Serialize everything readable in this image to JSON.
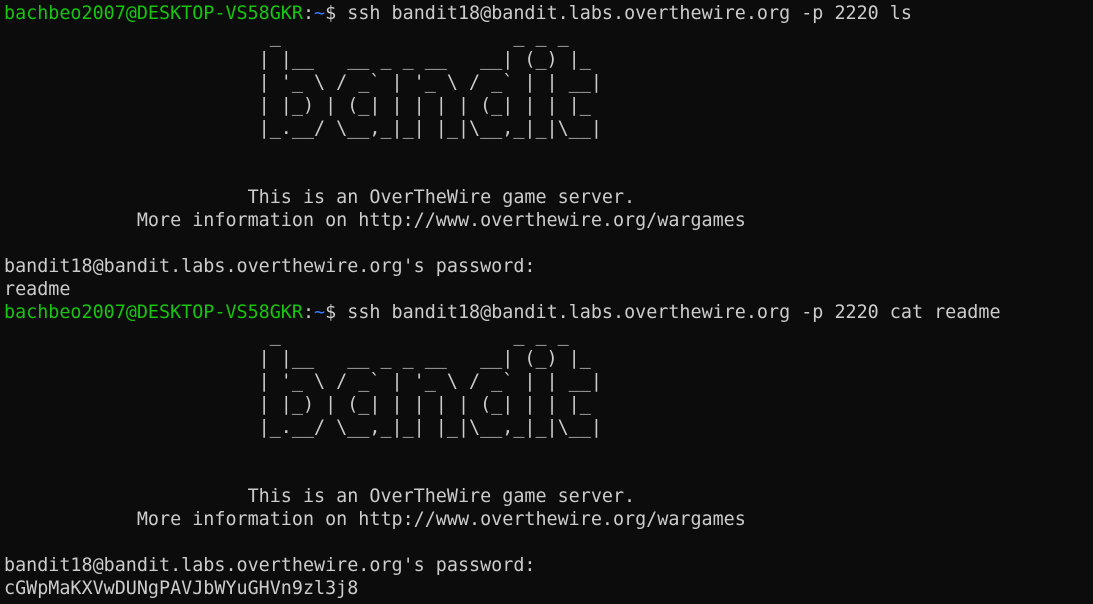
{
  "terminal": {
    "prompt": {
      "user_host": "bachbeo2007@DESKTOP-VS58GKR",
      "separator": ":",
      "path": "~",
      "symbol": "$ "
    },
    "blocks": [
      {
        "command": "ssh bandit18@bandit.labs.overthewire.org -p 2220 ls",
        "banner": [
          "                        _                     _ _ _",
          "                       | |__   __ _ _ __   __| (_) |_",
          "                       | '_ \\ / _` | '_ \\ / _` | | __|",
          "                       | |_) | (_| | | | | (_| | | |_",
          "                       |_.__/ \\__,_|_| |_|\\__,_|_|\\__|",
          "",
          "",
          "                      This is an OverTheWire game server.",
          "            More information on http://www.overthewire.org/wargames",
          ""
        ],
        "password_prompt": "bandit18@bandit.labs.overthewire.org's password: ",
        "output": "readme"
      },
      {
        "command": "ssh bandit18@bandit.labs.overthewire.org -p 2220 cat readme",
        "banner": [
          "                        _                     _ _ _",
          "                       | |__   __ _ _ __   __| (_) |_",
          "                       | '_ \\ / _` | '_ \\ / _` | | __|",
          "                       | |_) | (_| | | | | (_| | | |_",
          "                       |_.__/ \\__,_|_| |_|\\__,_|_|\\__|",
          "",
          "",
          "                      This is an OverTheWire game server.",
          "            More information on http://www.overthewire.org/wargames",
          ""
        ],
        "password_prompt": "bandit18@bandit.labs.overthewire.org's password: ",
        "output": "cGWpMaKXVwDUNgPAVJbWYuGHVn9zl3j8"
      }
    ],
    "colors": {
      "background": "#0c0c0c",
      "text": "#cccccc",
      "user_host": "#16c60c",
      "path": "#3b78ff"
    }
  }
}
